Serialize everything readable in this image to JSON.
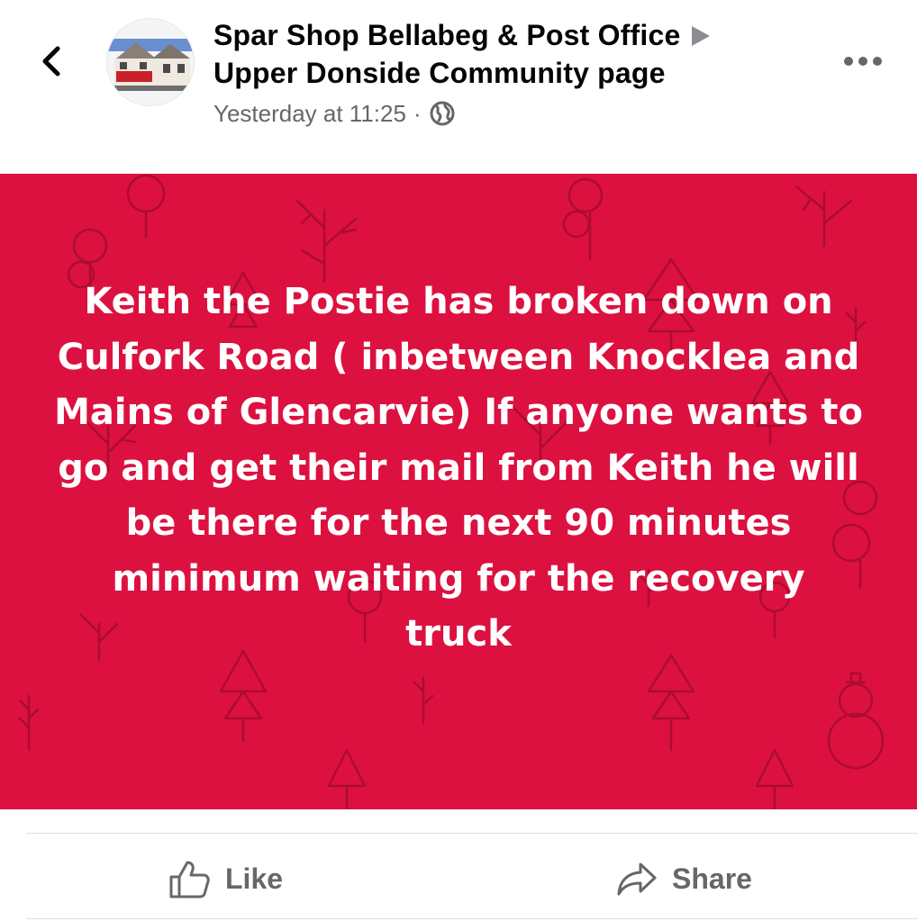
{
  "post": {
    "page_name": "Spar Shop Bellabeg & Post Office",
    "group_name": "Upper Donside Community page",
    "timestamp": "Yesterday at 11:25",
    "separator": "·",
    "audience_icon": "globe-icon",
    "body_text": "Keith the Postie has broken down on Culfork Road ( inbetween Knocklea and Mains of Glencarvie) If anyone wants to go and get their mail from Keith he will be there for the next 90 minutes minimum waiting for the recovery truck",
    "background_color": "#dc1140",
    "text_color": "#ffffff"
  },
  "actions": {
    "like_label": "Like",
    "share_label": "Share",
    "like_icon": "thumbs-up-icon",
    "share_icon": "share-arrow-icon"
  },
  "navigation": {
    "back_icon": "chevron-left-icon",
    "more_icon": "more-horizontal-icon",
    "arrow_icon": "triangle-right-icon"
  },
  "colors": {
    "primary_text": "#050505",
    "secondary_text": "#65676b",
    "divider": "#dcdde1"
  }
}
